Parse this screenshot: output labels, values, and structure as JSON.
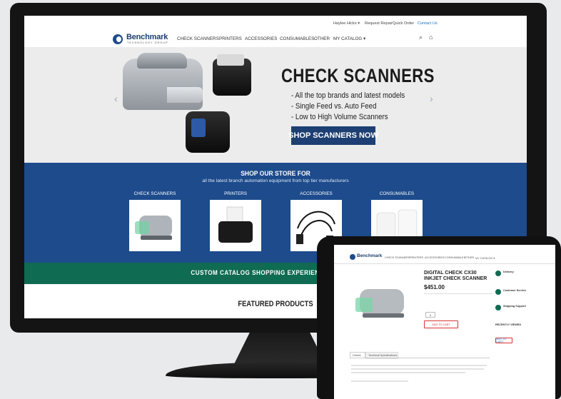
{
  "desktop": {
    "utility_nav": [
      "Haylee Hicks ▾",
      "Request Repair",
      "Quick Order",
      "Contact Us"
    ],
    "logo": {
      "name": "Benchmark",
      "tagline": "TECHNOLOGY GROUP"
    },
    "main_nav": [
      "CHECK SCANNERS",
      "PRINTERS",
      "ACCESSORIES",
      "CONSUMABLES",
      "OTHER",
      "MY CATALOG ▾"
    ],
    "icons": {
      "search": "⌕",
      "cart": "⌂",
      "prev": "‹",
      "next": "›"
    },
    "hero": {
      "title": "CHECK SCANNERS",
      "bullets": [
        "- All the top brands and latest models",
        "- Single Feed vs. Auto Feed",
        "- Low to High Volume Scanners"
      ],
      "cta": "SHOP SCANNERS NOW"
    },
    "store": {
      "title": "SHOP OUR STORE FOR",
      "subtitle": "all the latest branch automation equipment from top tier manufacturers",
      "categories": [
        "CHECK SCANNERS",
        "PRINTERS",
        "ACCESSORIES",
        "CONSUMABLES"
      ]
    },
    "banner": "CUSTOM CATALOG SHOPPING EXPERIENCE OFFERED",
    "featured": "FEATURED PRODUCTS"
  },
  "tablet": {
    "product_title": "DIGITAL CHECK CX30 INKJET CHECK SCANNER",
    "price": "$451.00",
    "add_to_cart": "ADD TO CART",
    "qty_value": "1",
    "tabs": [
      "Details",
      "Technical Specifications"
    ],
    "side_headings": [
      "Delivery",
      "Customer Service",
      "Shipping Support"
    ],
    "recently_viewed": "RECENTLY VIEWED"
  },
  "colors": {
    "navy": "#1d4b8c",
    "dark_navy": "#1d3f73",
    "green": "#0f6b52",
    "link_blue": "#1d6fc6"
  }
}
